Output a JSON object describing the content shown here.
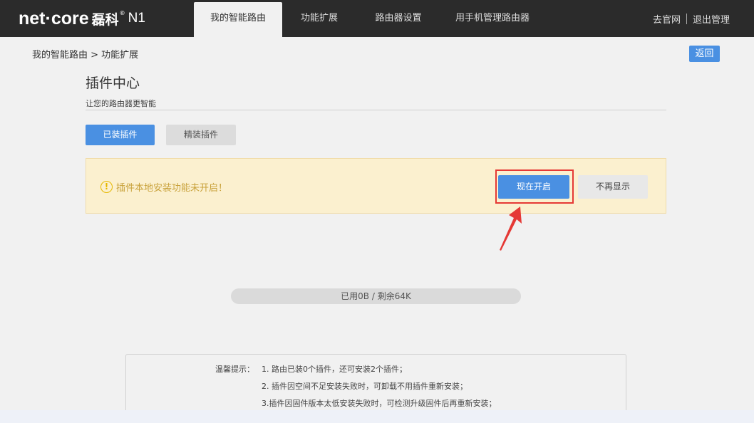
{
  "header": {
    "brand": "net·core",
    "brand_cn": "磊科",
    "model": "N1",
    "nav": [
      {
        "label": "我的智能路由",
        "active": true
      },
      {
        "label": "功能扩展",
        "active": false
      },
      {
        "label": "路由器设置",
        "active": false
      },
      {
        "label": "用手机管理路由器",
        "active": false
      }
    ],
    "links": {
      "official_site": "去官网",
      "logout": "退出管理"
    }
  },
  "breadcrumb": "我的智能路由 > 功能扩展",
  "back_label": "返回",
  "page": {
    "title": "插件中心",
    "subtitle": "让您的路由器更智能",
    "tabs": {
      "installed": "已装插件",
      "featured": "精装插件"
    }
  },
  "notice": {
    "icon": "warning-icon",
    "message": "插件本地安装功能未开启！",
    "enable_label": "现在开启",
    "dismiss_label": "不再显示"
  },
  "storage": {
    "label": "已用0B / 剩余64K",
    "used_fraction": 0
  },
  "tips": {
    "label": "温馨提示：",
    "lines": [
      "1. 路由已装0个插件，还可安装2个插件；",
      "2. 插件因空间不足安装失败时，可卸载不用插件重新安装；",
      "3.插件因固件版本太低安装失败时，可检测升级固件后再重新安装；"
    ]
  },
  "colors": {
    "accent": "#4a90e2",
    "topbar": "#2b2b2b",
    "notice_bg": "#fbf0cf",
    "highlight": "#e53935"
  }
}
